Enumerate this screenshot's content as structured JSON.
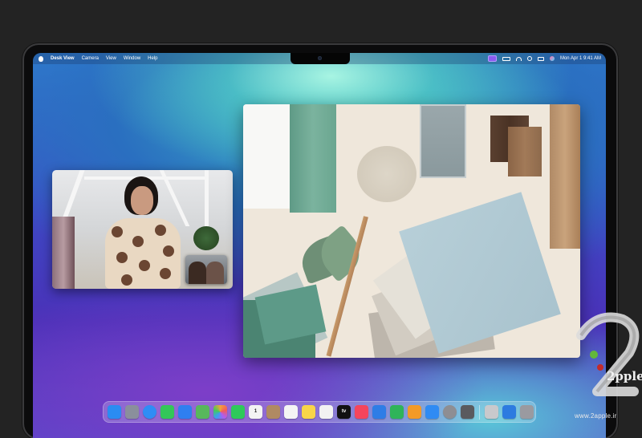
{
  "menubar": {
    "app_name": "Desk View",
    "menus": [
      "Camera",
      "View",
      "Window",
      "Help"
    ],
    "clock": "Mon Apr 1  9:41 AM",
    "status_icons": [
      "video-icon",
      "battery-icon",
      "wifi-icon",
      "search-icon",
      "control-center-icon",
      "siri-icon"
    ]
  },
  "windows": {
    "facetime": {
      "semantic": "facetime-video-call"
    },
    "desk_view": {
      "semantic": "desk-view-overhead-camera"
    }
  },
  "dock": {
    "apps": [
      {
        "name": "finder-icon",
        "color": "#2a8cf2"
      },
      {
        "name": "launchpad-icon",
        "color": "#8a8f9c"
      },
      {
        "name": "safari-icon",
        "color": "#2f8df5"
      },
      {
        "name": "messages-icon",
        "color": "#33c759"
      },
      {
        "name": "mail-icon",
        "color": "#2f7ff0"
      },
      {
        "name": "maps-icon",
        "color": "#58b85c"
      },
      {
        "name": "photos-icon",
        "color": "#f2a33a"
      },
      {
        "name": "facetime-icon",
        "color": "#2ec95a"
      },
      {
        "name": "calendar-icon",
        "color": "#f3f3f3",
        "label": "1"
      },
      {
        "name": "contacts-icon",
        "color": "#b08a62"
      },
      {
        "name": "reminders-icon",
        "color": "#f4f4f4"
      },
      {
        "name": "notes-icon",
        "color": "#f8d549"
      },
      {
        "name": "freeform-icon",
        "color": "#f2f2f2"
      },
      {
        "name": "tv-icon",
        "color": "#111111",
        "label": "tv"
      },
      {
        "name": "music-icon",
        "color": "#f5455c"
      },
      {
        "name": "keynote-icon",
        "color": "#2e7de6"
      },
      {
        "name": "numbers-icon",
        "color": "#2fb45a"
      },
      {
        "name": "pages-icon",
        "color": "#f39a26"
      },
      {
        "name": "app-store-icon",
        "color": "#2f8bf3"
      },
      {
        "name": "settings-icon",
        "color": "#8e8e93"
      },
      {
        "name": "iphone-mirroring-icon",
        "color": "#5a5a5e"
      }
    ],
    "right_items": [
      {
        "name": "preview-icon",
        "color": "#c9c9cc"
      },
      {
        "name": "desk-view-icon",
        "color": "#2d7be0"
      },
      {
        "name": "trash-icon",
        "color": "#9a9aa0"
      }
    ]
  },
  "watermark": {
    "brand": "2pple",
    "url": "www.2apple.ir"
  }
}
